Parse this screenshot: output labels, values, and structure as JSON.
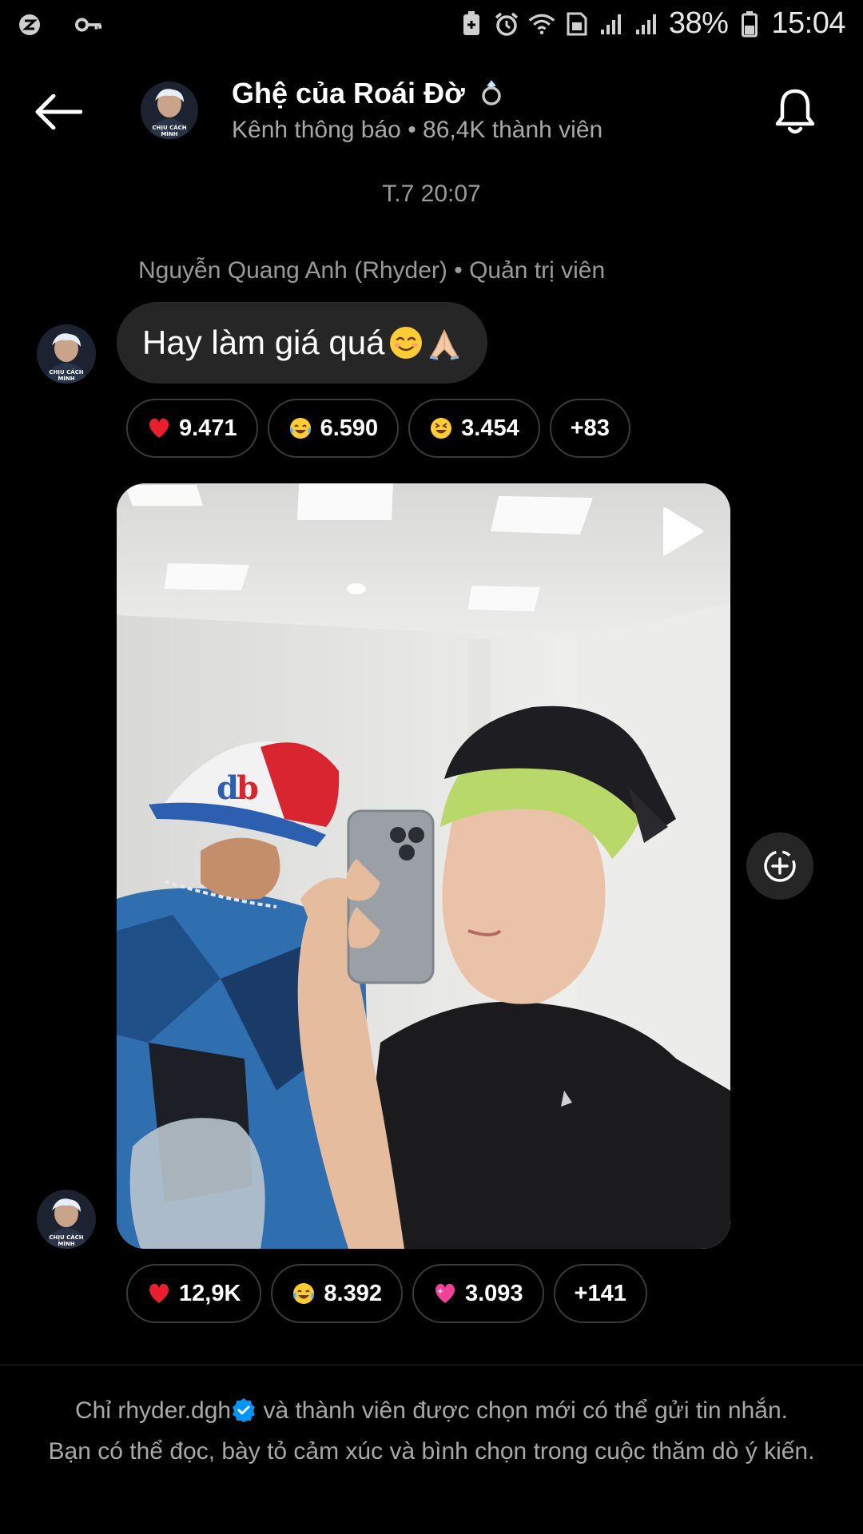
{
  "status_bar": {
    "battery": "38%",
    "time": "15:04"
  },
  "header": {
    "title": "Ghệ của Roái Đờ",
    "title_icon": "ring-emoji",
    "subtitle": "Kênh thông báo • 86,4K thành viên",
    "avatar_caption": "CHỊU CÁCH MÌNH"
  },
  "chat": {
    "timestamp": "T.7 20:07",
    "sender": "Nguyễn Quang Anh (Rhyder) • Quản trị viên",
    "message_text": "Hay làm giá quá",
    "message_emojis": [
      "smiling-face",
      "folded-hands"
    ],
    "message_reactions": [
      {
        "emoji": "red-heart",
        "count": "9.471"
      },
      {
        "emoji": "tears-of-joy",
        "count": "6.590"
      },
      {
        "emoji": "grinning-squinting",
        "count": "3.454"
      },
      {
        "emoji": "",
        "count": "+83"
      }
    ],
    "photo_reactions": [
      {
        "emoji": "red-heart",
        "count": "12,9K"
      },
      {
        "emoji": "tears-of-joy",
        "count": "8.392"
      },
      {
        "emoji": "sparkling-heart",
        "count": "3.093"
      },
      {
        "emoji": "",
        "count": "+141"
      }
    ]
  },
  "footer": {
    "username": "Chỉ rhyder.dgh",
    "line1_rest": " và thành viên được chọn mới có thể gửi tin nhắn.",
    "line2": "Bạn có thể đọc, bày tỏ cảm xúc và bình chọn trong cuộc thăm dò ý kiến."
  },
  "colors": {
    "background": "#000000",
    "bubble": "#262626",
    "muted_text": "#9a9a9a",
    "verified_blue": "#0095f6"
  }
}
